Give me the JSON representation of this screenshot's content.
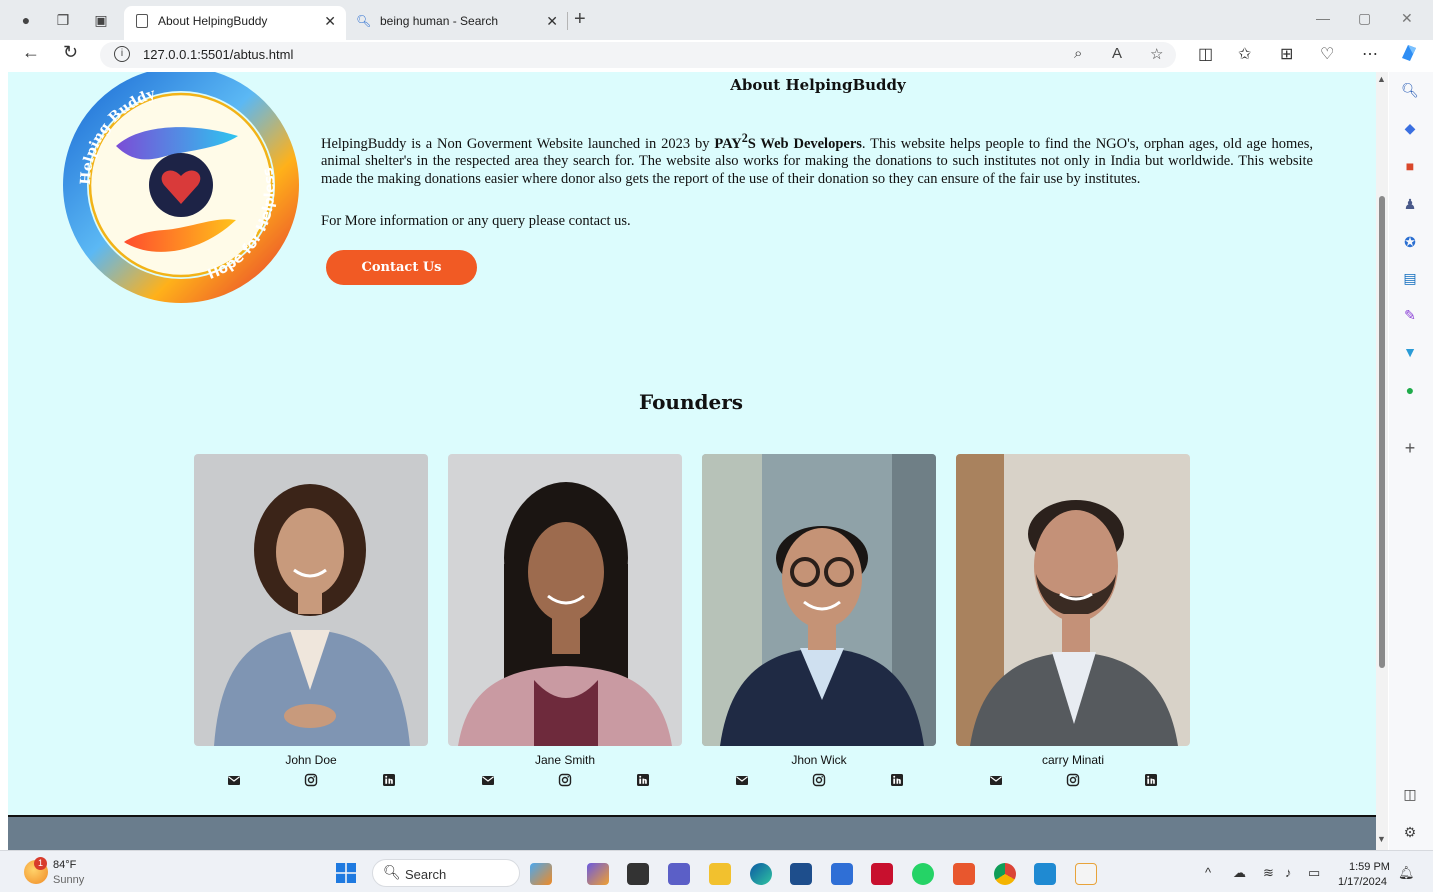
{
  "browser": {
    "tabs": [
      {
        "title": "About HelpingBuddy",
        "active": true
      },
      {
        "title": "being human - Search",
        "active": false
      }
    ],
    "url": "127.0.0.1:5501/abtus.html"
  },
  "page": {
    "about_title": "About HelpingBuddy",
    "about_intro": "HelpingBuddy is a Non Goverment Website launched in 2023 by ",
    "about_brand_prefix": "PAY",
    "about_brand_sup": "2",
    "about_brand_suffix": "S Web Developers",
    "about_rest": ". This website helps people to find the NGO's, orphan ages, old age homes, animal shelter's in the respected area they search for. The website also works for making the donations to such institutes not only in India but worldwide. This website made the making donations easier where donor also gets the report of the use of their donation so they can ensure of the fair use by institutes.",
    "contact_line": "For More information or any query please contact us.",
    "contact_button": "Contact Us",
    "logo_text_top": "Helping Buddy",
    "logo_text_bottom": "Hope for Helpless",
    "founders_title": "Founders",
    "founders": [
      {
        "name": "John Doe"
      },
      {
        "name": "Jane Smith"
      },
      {
        "name": "Jhon Wick"
      },
      {
        "name": "carry Minati"
      }
    ]
  },
  "taskbar": {
    "weather_temp": "84°F",
    "weather_cond": "Sunny",
    "weather_badge": "1",
    "search_placeholder": "Search",
    "time": "1:59 PM",
    "date": "1/17/2024"
  },
  "colors": {
    "page_bg": "#dcfcfd",
    "button": "#f15a24",
    "footer": "#6a7d8d"
  }
}
